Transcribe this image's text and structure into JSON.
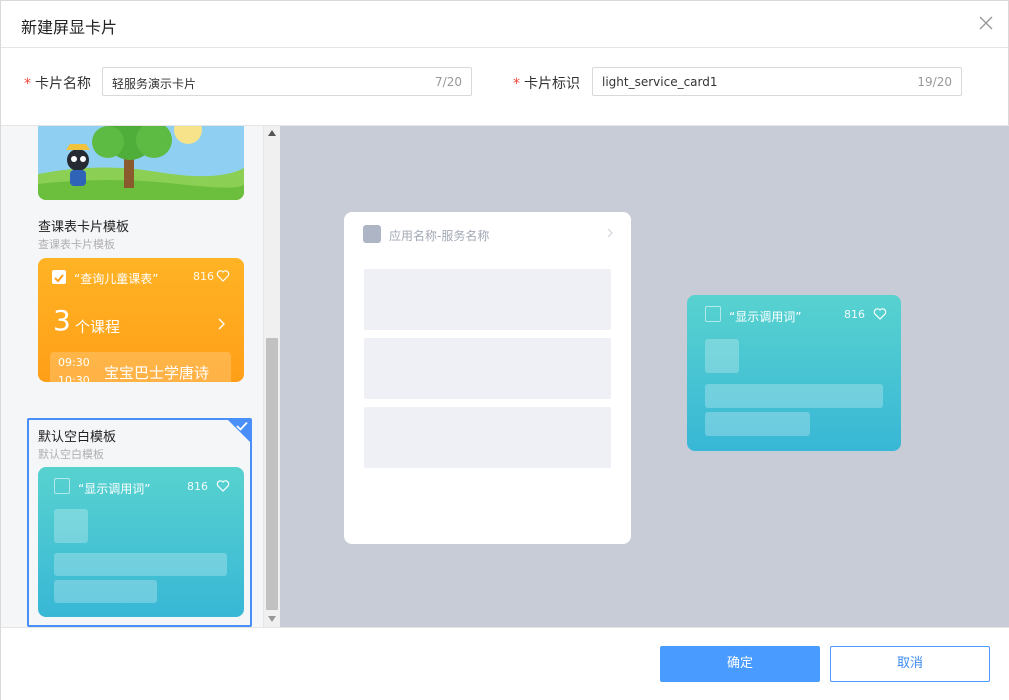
{
  "dialog": {
    "title": "新建屏显卡片"
  },
  "form": {
    "name": {
      "required_mark": "*",
      "label": "卡片名称",
      "value": "轻服务演示卡片",
      "count": "7/20"
    },
    "id": {
      "required_mark": "*",
      "label": "卡片标识",
      "value": "light_service_card1",
      "count": "19/20"
    }
  },
  "templates": [
    {
      "title": "查课表卡片模板",
      "subtitle": "查课表卡片模板"
    },
    {
      "title": "默认空白模板",
      "subtitle": "默认空白模板"
    }
  ],
  "schedule_card": {
    "query": "“查询儿童课表”",
    "count": "816",
    "courses": "3",
    "courses_unit": "个课程",
    "time_start": "09:30",
    "time_end": "10:30",
    "course_name": "宝宝巴士学唐诗"
  },
  "blank_card": {
    "text": "“显示调用词”",
    "count": "816"
  },
  "preview": {
    "app_name": "应用名称-服务名称",
    "card_text": "“显示调用词”",
    "card_count": "816"
  },
  "footer": {
    "confirm_label": "确定",
    "cancel_label": "取消"
  },
  "colors": {
    "accent": "#4a9bff",
    "teal": "#45c4d3",
    "orange": "#ffa51e"
  },
  "icons": {
    "close": "close-icon",
    "heart": "heart-icon",
    "check": "check-icon",
    "chevron": "chevron-right-icon"
  }
}
